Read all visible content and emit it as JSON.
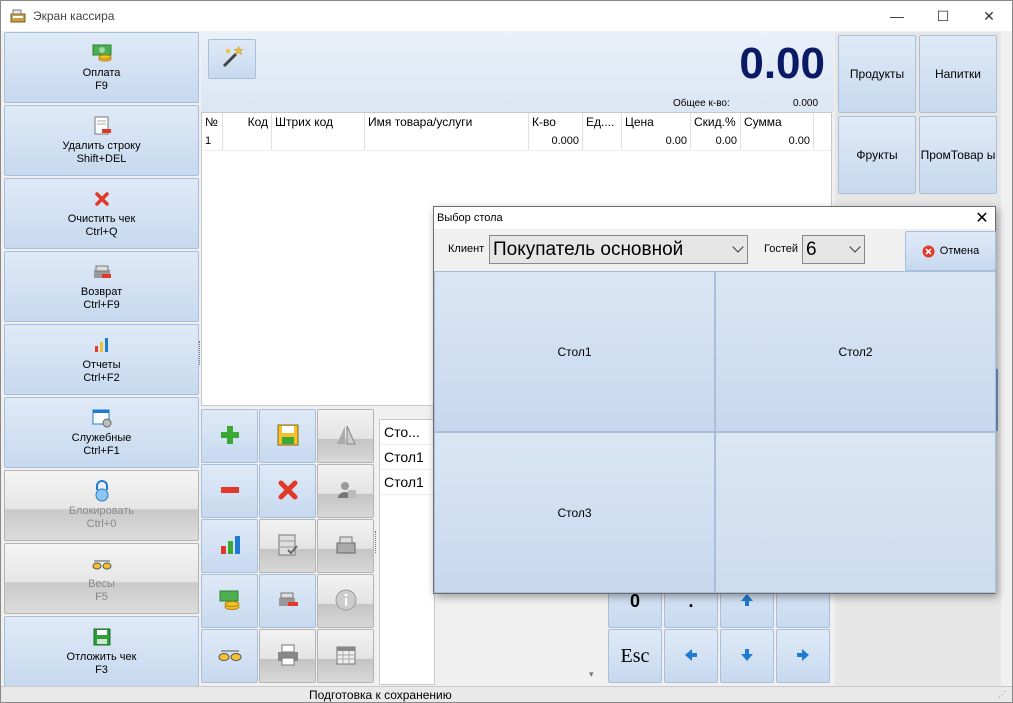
{
  "window": {
    "title": "Экран кассира",
    "controls": {
      "minimize": "—",
      "maximize": "☐",
      "close": "✕"
    }
  },
  "left_menu": [
    {
      "label": "Оплата",
      "shortcut": "F9",
      "icon": "money-stack-icon",
      "enabled": true
    },
    {
      "label": "Удалить строку",
      "shortcut": "Shift+DEL",
      "icon": "delete-line-icon",
      "enabled": true
    },
    {
      "label": "Очистить чек",
      "shortcut": "Ctrl+Q",
      "icon": "red-x-icon",
      "enabled": true
    },
    {
      "label": "Возврат",
      "shortcut": "Ctrl+F9",
      "icon": "return-icon",
      "enabled": true
    },
    {
      "label": "Отчеты",
      "shortcut": "Ctrl+F2",
      "icon": "bar-chart-icon",
      "enabled": true
    },
    {
      "label": "Служебные",
      "shortcut": "Ctrl+F1",
      "icon": "service-window-icon",
      "enabled": true
    },
    {
      "label": "Блокировать",
      "shortcut": "Ctrl+0",
      "icon": "lock-icon",
      "enabled": false
    },
    {
      "label": "Весы",
      "shortcut": "F5",
      "icon": "scales-icon",
      "enabled": false
    },
    {
      "label": "Отложить чек",
      "shortcut": "F3",
      "icon": "floppy-icon",
      "enabled": true
    }
  ],
  "summary": {
    "total": "0.00",
    "qty_label": "Общее к-во:",
    "qty_value": "0.000"
  },
  "receipt": {
    "columns": [
      "№",
      "Код",
      "Штрих код",
      "Имя товара/услуги",
      "К-во",
      "Ед....",
      "Цена",
      "Скид.%",
      "Сумма"
    ],
    "rows": [
      [
        "1",
        "",
        "",
        "",
        "0.000",
        "",
        "0.00",
        "0.00",
        "0.00"
      ]
    ]
  },
  "categories": [
    "Продукты",
    "Напитки",
    "Фрукты",
    "ПромТовар ы"
  ],
  "tables_list": [
    "Сто...",
    "Стол1",
    "Стол1"
  ],
  "numpad": {
    "zero": "0",
    "dot": ".",
    "esc": "Esc"
  },
  "status": {
    "text": "Подготовка к сохранению"
  },
  "dialog": {
    "title": "Выбор стола",
    "close": "✕",
    "client_label": "Клиент",
    "client_value": "Покупатель основной",
    "guests_label": "Гостей",
    "guests_value": "6",
    "cancel_label": "Отмена",
    "tables": [
      "Стол1",
      "Стол2",
      "Стол3",
      ""
    ]
  },
  "colors": {
    "total": "#0a1a66",
    "button_blue": "#c7d9ef",
    "button_gray": "#dcdcdc",
    "accent_red": "#e2382a",
    "accent_green": "#3aa832"
  }
}
